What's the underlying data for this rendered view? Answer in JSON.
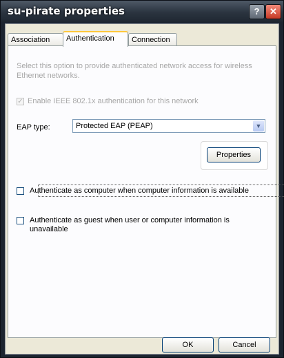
{
  "window": {
    "title": "su-pirate properties",
    "help_label": "?",
    "close_label": "✕"
  },
  "tabs": [
    {
      "label": "Association"
    },
    {
      "label": "Authentication"
    },
    {
      "label": "Connection"
    }
  ],
  "auth": {
    "description": "Select this option to provide authenticated network access for wireless Ethernet networks.",
    "enable_8021x_label": "Enable IEEE 802.1x authentication for this network",
    "eap_type_label": "EAP type:",
    "eap_type_value": "Protected EAP (PEAP)",
    "properties_label": "Properties",
    "auth_computer_label": "Authenticate as computer when computer information is available",
    "auth_guest_label": "Authenticate as guest when user or computer information is unavailable"
  },
  "footer": {
    "ok_label": "OK",
    "cancel_label": "Cancel"
  },
  "icons": {
    "check": "✓",
    "dropdown": "▼"
  }
}
